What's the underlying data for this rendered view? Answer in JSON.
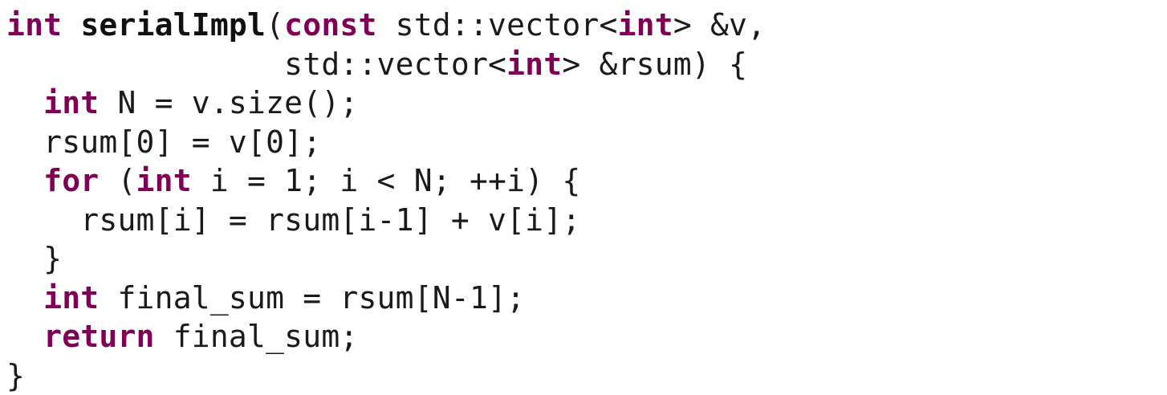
{
  "colors": {
    "keyword": "#7f0055",
    "text": "#1a1a1a",
    "background": "#ffffff"
  },
  "code": {
    "lines": [
      [
        {
          "t": "int",
          "k": "kw"
        },
        {
          "t": " ",
          "k": "tx"
        },
        {
          "t": "serialImpl",
          "k": "fn"
        },
        {
          "t": "(",
          "k": "tx"
        },
        {
          "t": "const",
          "k": "kw"
        },
        {
          "t": " std::vector<",
          "k": "tx"
        },
        {
          "t": "int",
          "k": "kw"
        },
        {
          "t": "> &v,",
          "k": "tx"
        }
      ],
      [
        {
          "t": "               std::vector<",
          "k": "tx"
        },
        {
          "t": "int",
          "k": "kw"
        },
        {
          "t": "> &rsum) {",
          "k": "tx"
        }
      ],
      [
        {
          "t": "  ",
          "k": "tx"
        },
        {
          "t": "int",
          "k": "kw"
        },
        {
          "t": " N = v.size();",
          "k": "tx"
        }
      ],
      [
        {
          "t": "  rsum[0] = v[0];",
          "k": "tx"
        }
      ],
      [
        {
          "t": "  ",
          "k": "tx"
        },
        {
          "t": "for",
          "k": "kw"
        },
        {
          "t": " (",
          "k": "tx"
        },
        {
          "t": "int",
          "k": "kw"
        },
        {
          "t": " i = 1; i < N; ++i) {",
          "k": "tx"
        }
      ],
      [
        {
          "t": "    rsum[i] = rsum[i-1] + v[i];",
          "k": "tx"
        }
      ],
      [
        {
          "t": "  }",
          "k": "tx"
        }
      ],
      [
        {
          "t": "  ",
          "k": "tx"
        },
        {
          "t": "int",
          "k": "kw"
        },
        {
          "t": " final_sum = rsum[N-1];",
          "k": "tx"
        }
      ],
      [
        {
          "t": "  ",
          "k": "tx"
        },
        {
          "t": "return",
          "k": "kw"
        },
        {
          "t": " final_sum;",
          "k": "tx"
        }
      ],
      [
        {
          "t": "}",
          "k": "tx"
        }
      ]
    ]
  }
}
